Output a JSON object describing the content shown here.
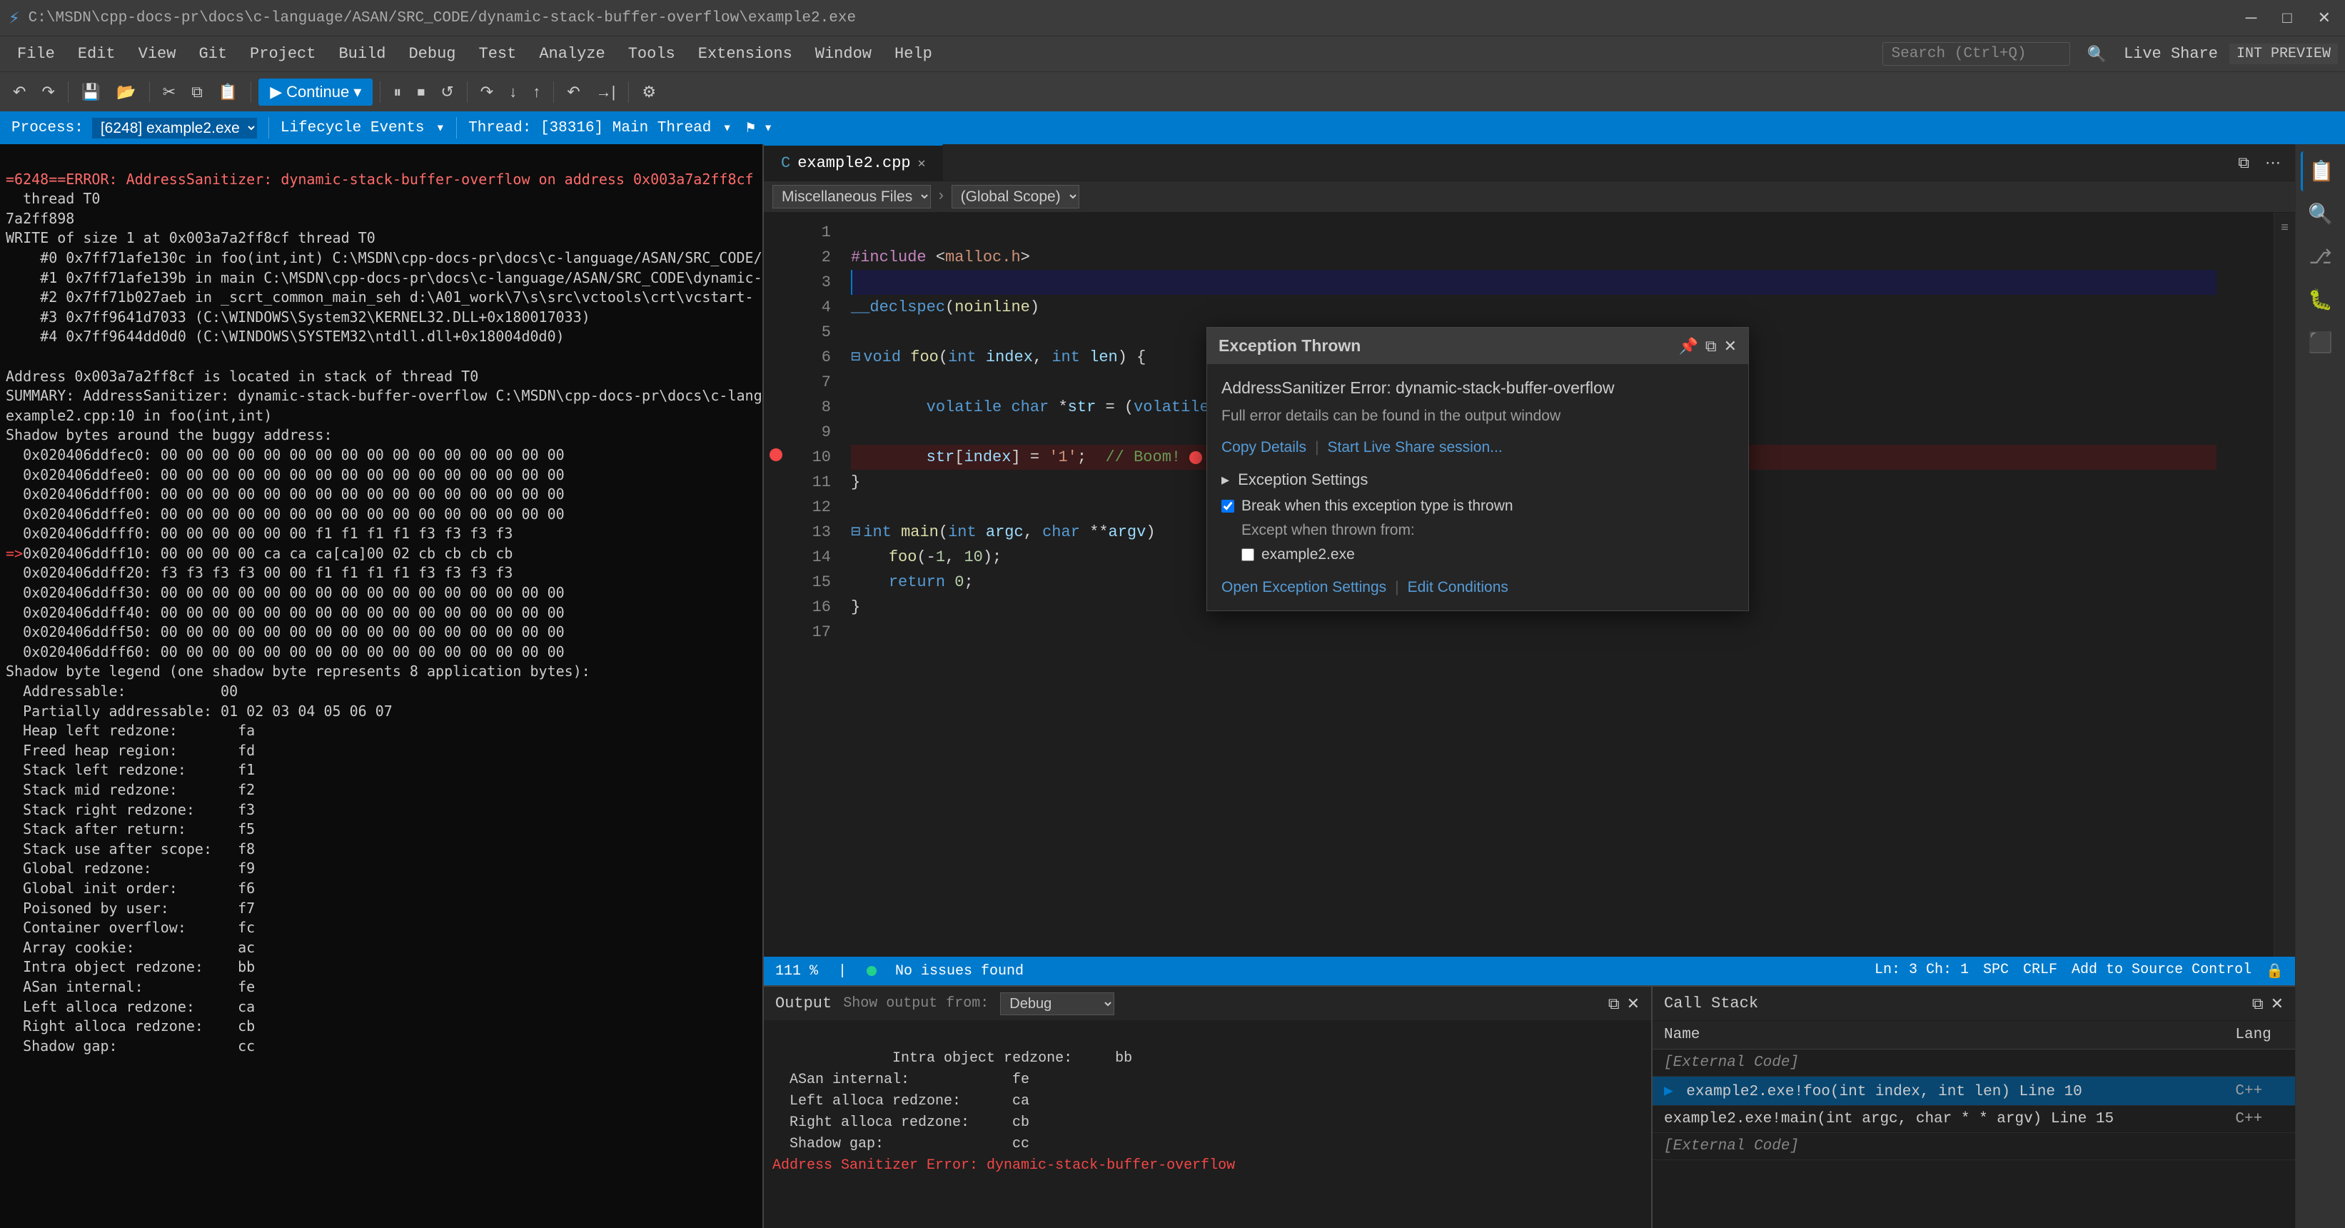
{
  "titleBar": {
    "path": "C:\\MSDN\\cpp-docs-pr\\docs\\c-language/ASAN/SRC_CODE/dynamic-stack-buffer-overflow\\example2.exe"
  },
  "menuBar": {
    "items": [
      "File",
      "Edit",
      "View",
      "Git",
      "Project",
      "Build",
      "Debug",
      "Test",
      "Analyze",
      "Tools",
      "Extensions",
      "Window",
      "Help"
    ]
  },
  "toolbar": {
    "searchPlaceholder": "Search (Ctrl+Q)",
    "continueLabel": "Continue",
    "liveShareLabel": "Live Share",
    "intPreviewLabel": "INT PREVIEW"
  },
  "debugBar": {
    "processLabel": "Process:",
    "processValue": "[6248] example2.exe",
    "lifecycleLabel": "Lifecycle Events",
    "threadLabel": "Thread: [38316] Main Thread"
  },
  "terminal": {
    "content": "=6248==ERROR: AddressSanitizer: dynamic-stack-buffer-overflow on address 0x003a7a2ff8cf\n  thread T0\n7a2ff898\nWRITE of size 1 at 0x003a7a2ff8cf thread T0\n    #0 0x7ff71afe130c in foo(int,int) C:\\MSDN\\cpp-docs-pr\\docs\\c-language/ASAN/SRC_CODE/dynamic-\n    #1 0x7ff71afe139b in main C:\\MSDN\\cpp-docs-pr\\docs\\c-language/ASAN/SRC_CODE\\dynamic-\n    #2 0x7ff71b027aeb in _scrt_common_main_seh d:\\A01_work\\7\\s\\src\\vctools\\crt\\vcstart-\n    #3 0x7ff9641d7033 (C:\\WINDOWS\\System32\\KERNEL32.DLL+0x180017033)\n    #4 0x7ff9644dd0d0 (C:\\WINDOWS\\SYSTEM32\\ntdll.dll+0x18004d0d0)\n\nAddress 0x003a7a2ff8cf is located in stack of thread T0\nSUMMARY: AddressSanitizer: dynamic-stack-buffer-overflow C:\\MSDN\\cpp-docs-pr\\docs\\c-lang-\nexample2.cpp:10 in foo(int,int)\nShadow bytes around the buggy address:\n  0x020406ddfec0: 00 00 00 00 00 00 00 00 00 00 00 00 00 00 00 00\n  0x020406ddfe e0: 00 00 00 00 00 00 00 00 00 00 00 00 00 00 00 00\n  0x020406ddff00: 00 00 00 00 00 00 00 00 00 00 00 00 00 00 00 00\n  0x020406ddffe0: 00 00 00 00 00 00 00 00 00 00 00 00 00 00 00 00\n  0x020406ddfff0: 00 00 00 00 00 00 f1 f1 f1 f1 f3 f3 f3 f3\n=>0x020406ddff10: 00 00 00 00 ca ca ca[ca]00 02 cb cb cb cb\n  0x020406ddff20: f3 f3 f3 f3 00 00 f1 f1 f1 f1 f3 f3 f3 f3\n  0x020406ddff30: 00 00 00 00 00 00 00 00 00 00 00 00 00 00 00 00\n  0x020406ddff40: 00 00 00 00 00 00 00 00 00 00 00 00 00 00 00 00\n  0x020406ddff50: 00 00 00 00 00 00 00 00 00 00 00 00 00 00 00 00\n  0x020406ddff60: 00 00 00 00 00 00 00 00 00 00 00 00 00 00 00 00\nShadow byte legend (one shadow byte represents 8 application bytes):\n  Addressable:           00\n  Partially addressable: 01 02 03 04 05 06 07\n  Heap left redzone:       fa\n  Freed heap region:       fd\n  Stack left redzone:      f1\n  Stack mid redzone:       f2\n  Stack right redzone:     f3\n  Stack after return:      f5\n  Stack use after scope:   f8\n  Global redzone:          f9\n  Global init order:       f6\n  Poisoned by user:        f7\n  Container overflow:      fc\n  Array cookie:            ac\n  Intra object redzone:    bb\n  ASan internal:           fe\n  Left alloca redzone:     ca\n  Right alloca redzone:    cb\n  Shadow gap:              cc"
  },
  "editor": {
    "tabName": "example2.cpp",
    "miscLabel": "Miscellaneous Files",
    "globalScope": "(Global Scope)",
    "lines": [
      {
        "num": 1,
        "code": ""
      },
      {
        "num": 2,
        "code": "#include <malloc.h>"
      },
      {
        "num": 3,
        "code": ""
      },
      {
        "num": 4,
        "code": "__declspec(noinline)"
      },
      {
        "num": 5,
        "code": ""
      },
      {
        "num": 6,
        "code": "void foo(int index, int len) {"
      },
      {
        "num": 7,
        "code": ""
      },
      {
        "num": 8,
        "code": "    volatile char *str = (volatile char *)_alloca(len);"
      },
      {
        "num": 9,
        "code": ""
      },
      {
        "num": 10,
        "code": "    str[index] = '1';  // Boom!"
      },
      {
        "num": 11,
        "code": "}"
      },
      {
        "num": 12,
        "code": ""
      },
      {
        "num": 13,
        "code": "int main(int argc, char **argv)"
      },
      {
        "num": 14,
        "code": "    foo(-1, 10);"
      },
      {
        "num": 15,
        "code": "    return 0;"
      },
      {
        "num": 16,
        "code": "}"
      },
      {
        "num": 17,
        "code": ""
      }
    ]
  },
  "exceptionPopup": {
    "title": "Exception Thrown",
    "errorTitle": "AddressSanitizer Error: dynamic-stack-buffer-overflow",
    "errorSub": "Full error details can be found in the output window",
    "link1": "Copy Details",
    "link2": "Start Live Share session...",
    "sectionTitle": "Exception Settings",
    "checkbox1Label": "Break when this exception type is thrown",
    "checkbox1Checked": true,
    "exceptLabel": "Except when thrown from:",
    "checkbox2Label": "example2.exe",
    "checkbox2Checked": false,
    "footerLink1": "Open Exception Settings",
    "footerSeparator": "|",
    "footerLink2": "Edit Conditions"
  },
  "statusBar": {
    "zoomLevel": "111 %",
    "noIssues": "No issues found",
    "lnCol": "Ln: 3  Ch: 1",
    "spc": "SPC",
    "crlf": "CRLF",
    "sourceControl": "Add to Source Control"
  },
  "outputPanel": {
    "title": "Output",
    "filterLabel": "Show output from:",
    "filterValue": "Debug",
    "content": "  Intra object redzone:     bb\n  ASan internal:            fe\n  Left alloca redzone:      ca\n  Right alloca redzone:     cb\n  Shadow gap:               cc\nAddress Sanitizer Error: dynamic-stack-buffer-overflow"
  },
  "callStack": {
    "title": "Call Stack",
    "columns": [
      "Name",
      "Lang"
    ],
    "frames": [
      {
        "name": "[External Code]",
        "lang": "",
        "external": true,
        "active": false
      },
      {
        "name": "example2.exe!foo(int index, int len) Line 10",
        "lang": "C++",
        "external": false,
        "active": true,
        "arrow": true
      },
      {
        "name": "example2.exe!main(int argc, char * * argv) Line 15",
        "lang": "C++",
        "external": false,
        "active": false
      },
      {
        "name": "[External Code]",
        "lang": "",
        "external": true,
        "active": false
      }
    ]
  },
  "icons": {
    "close": "✕",
    "minimize": "─",
    "maximize": "□",
    "pin": "📌",
    "popout": "⧉",
    "chevronDown": "▾",
    "play": "▶",
    "pause": "⏸",
    "stop": "⏹",
    "stepOver": "↷",
    "stepInto": "↓",
    "stepOut": "↑",
    "restart": "↺",
    "search": "🔍",
    "gear": "⚙",
    "file": "📄",
    "folder": "📁",
    "debug": "🐛",
    "extensions": "⬛",
    "sourceControl": "⎇",
    "explorer": "📋"
  },
  "colors": {
    "accent": "#007acc",
    "errorRed": "#f44747",
    "warningYellow": "#d7ba7d",
    "successGreen": "#23d18b"
  }
}
